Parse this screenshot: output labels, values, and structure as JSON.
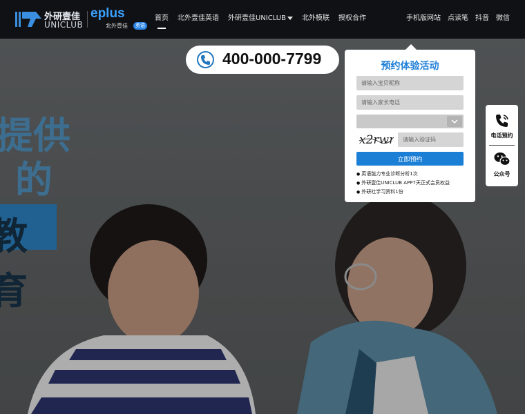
{
  "header": {
    "logo_primary_cn": "外研壹佳",
    "logo_primary_en": "UNICLUB",
    "logo_secondary_brand": "eplus",
    "logo_secondary_sub": "北外壹佳",
    "logo_secondary_badge": "英语",
    "nav": [
      {
        "label": "首页",
        "active": true
      },
      {
        "label": "北外壹佳英语",
        "active": false
      },
      {
        "label": "外研壹佳UNICLUB",
        "active": false,
        "has_dropdown": true
      },
      {
        "label": "北外模联",
        "active": false
      },
      {
        "label": "授权合作",
        "active": false
      }
    ],
    "nav_right": [
      {
        "label": "手机版网站"
      },
      {
        "label": "点读笔"
      },
      {
        "label": "抖音"
      },
      {
        "label": "微信"
      }
    ]
  },
  "hero": {
    "text_chars": [
      "提供",
      "的",
      "教育"
    ],
    "accent_color": "#2e87c9"
  },
  "phone": {
    "number": "400-000-7799",
    "icon": "phone-icon"
  },
  "form": {
    "title": "预约体验活动",
    "child_name_placeholder": "请输入宝贝昵称",
    "parent_phone_placeholder": "请输入家长电话",
    "select_value": "",
    "captcha_text": "x2rwrs",
    "captcha_placeholder": "请输入验证码",
    "submit_label": "立即预约",
    "perks": [
      "英语能力专业诊断分析1次",
      "外研壹佳UNICLUB APP7天正式会员权益",
      "外研社学习资料1份"
    ]
  },
  "side_bar": {
    "phone_label": "电话预约",
    "wechat_label": "公众号"
  },
  "colors": {
    "header_bg": "#101114",
    "brand_blue": "#1b7fd6",
    "title_blue": "#1e7fd7"
  }
}
